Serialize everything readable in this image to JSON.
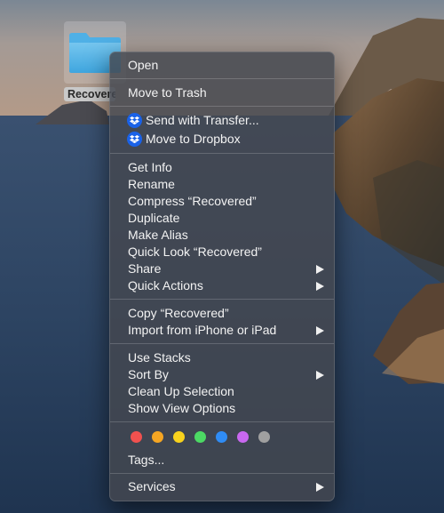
{
  "desktop": {
    "folder_label": "Recovered"
  },
  "menu": {
    "open": "Open",
    "move_to_trash": "Move to Trash",
    "send_with_transfer": "Send with Transfer...",
    "move_to_dropbox": "Move to Dropbox",
    "get_info": "Get Info",
    "rename": "Rename",
    "compress": "Compress “Recovered”",
    "duplicate": "Duplicate",
    "make_alias": "Make Alias",
    "quick_look": "Quick Look “Recovered”",
    "share": "Share",
    "quick_actions": "Quick Actions",
    "copy": "Copy “Recovered”",
    "import_from_iphone": "Import from iPhone or iPad",
    "use_stacks": "Use Stacks",
    "sort_by": "Sort By",
    "clean_up_selection": "Clean Up Selection",
    "show_view_options": "Show View Options",
    "tags": "Tags...",
    "services": "Services"
  },
  "tag_colors": [
    "#f0514f",
    "#f5a623",
    "#f8d21d",
    "#4cd964",
    "#2f8cf5",
    "#c968f0",
    "#a0a0a0"
  ],
  "icons": {
    "folder": "folder-icon",
    "dropbox": "dropbox-icon",
    "submenu": "chevron-right-icon"
  }
}
